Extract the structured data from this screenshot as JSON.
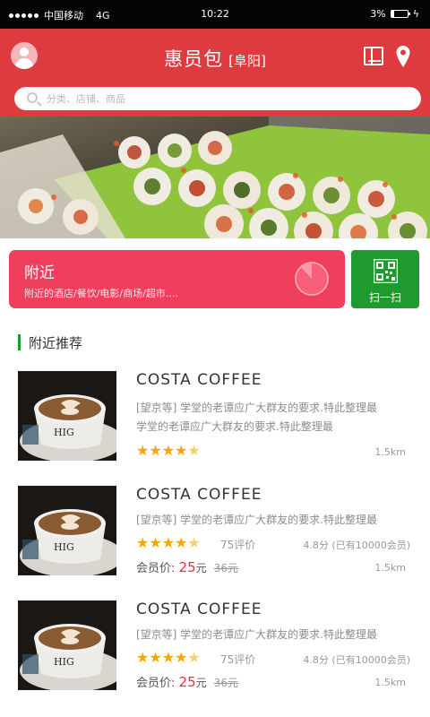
{
  "status_bar": {
    "carrier": "中国移动",
    "network": "4G",
    "time": "10:22",
    "battery": "3%",
    "signal_dots": 5
  },
  "header": {
    "title": "惠员包",
    "city": "[阜阳]",
    "avatar_icon": "user-avatar-icon",
    "book_icon": "book-icon",
    "location_icon": "location-pin-icon",
    "background": "#dd3b3f"
  },
  "search": {
    "placeholder": "分类、店铺、商品",
    "value": ""
  },
  "banner": {
    "image": "sushi-platter"
  },
  "nearby_card": {
    "title": "附近",
    "subtitle": "附近的酒店/餐饮/电影/商场/超市....",
    "color": "#f03f5d"
  },
  "scan_card": {
    "label": "扫一扫",
    "icon": "qr-code-icon",
    "color": "#1e9a2e"
  },
  "section": {
    "title": "附近推荐",
    "accent": "#1e9a2e"
  },
  "items": [
    {
      "name": "COSTA  COFFEE",
      "desc_line1": "[望京等]  学堂的老谭应广大群友的要求.特此整理最",
      "desc_line2": "学堂的老谭应广大群友的要求.特此整理最",
      "rating": 4.5,
      "stars": "★★★★",
      "half_star": "★",
      "reviews": "",
      "score": "",
      "price_label": "",
      "price": "",
      "price_unit": "",
      "old_price": "",
      "distance": "1.5km"
    },
    {
      "name": "COSTA  COFFEE",
      "desc_line1": "[望京等]  学堂的老谭应广大群友的要求.特此整理最",
      "desc_line2": "",
      "rating": 4.5,
      "stars": "★★★★",
      "half_star": "★",
      "reviews": "75评价",
      "score": "4.8分 (已有10000会员)",
      "price_label": "会员价:",
      "price": "25",
      "price_unit": "元",
      "old_price": "36元",
      "distance": "1.5km"
    },
    {
      "name": "COSTA  COFFEE",
      "desc_line1": "[望京等]  学堂的老谭应广大群友的要求.特此整理最",
      "desc_line2": "",
      "rating": 4.5,
      "stars": "★★★★",
      "half_star": "★",
      "reviews": "75评价",
      "score": "4.8分 (已有10000会员)",
      "price_label": "会员价:",
      "price": "25",
      "price_unit": "元",
      "old_price": "36元",
      "distance": "1.5km"
    }
  ],
  "colors": {
    "star": "#f5a400",
    "price": "#e02f36"
  }
}
